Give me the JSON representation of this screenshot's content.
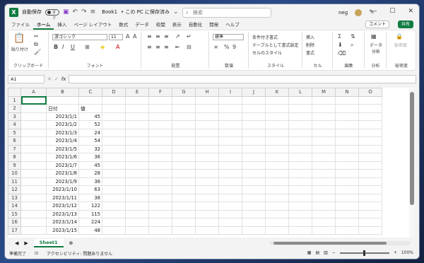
{
  "titlebar": {
    "autosave_label": "自動保存",
    "autosave_state": "オフ",
    "book_title": "Book1",
    "save_status": "• この PC に保存済み",
    "search_placeholder": "検索",
    "user_name": "neg"
  },
  "tabs": [
    "ファイル",
    "ホーム",
    "挿入",
    "ページ レイアウト",
    "数式",
    "データ",
    "校閲",
    "表示",
    "自動化",
    "開発",
    "ヘルプ"
  ],
  "active_tab": "ホーム",
  "comment_label": "コメント",
  "share_label": "共有",
  "ribbon": {
    "clipboard": {
      "paste": "貼り付け",
      "label": "クリップボード"
    },
    "font": {
      "name": "游ゴシック",
      "size": "11",
      "label": "フォント"
    },
    "alignment": {
      "label": "配置"
    },
    "number": {
      "format": "標準",
      "label": "数値"
    },
    "styles": {
      "conditional": "条件付き書式",
      "table": "テーブルとして書式設定",
      "cell": "セルのスタイル",
      "label": "スタイル"
    },
    "cells": {
      "insert": "挿入",
      "delete": "削除",
      "format": "書式",
      "label": "セル"
    },
    "editing": {
      "label": "編集"
    },
    "analysis": {
      "data_analysis": "データ分析",
      "label": "分析"
    },
    "sensitivity": {
      "label": "秘密度",
      "title": "秘密度"
    }
  },
  "formula_bar": {
    "cell_ref": "A1",
    "fx": "fx",
    "value": ""
  },
  "grid": {
    "columns": [
      "A",
      "B",
      "C",
      "D",
      "E",
      "F",
      "G",
      "H",
      "I",
      "J",
      "K",
      "L",
      "M",
      "N",
      "O"
    ],
    "header_date": "日付",
    "header_value": "値",
    "rows": [
      {
        "date": "2023/1/1",
        "value": "45"
      },
      {
        "date": "2023/1/2",
        "value": "52"
      },
      {
        "date": "2023/1/3",
        "value": "24"
      },
      {
        "date": "2023/1/4",
        "value": "54"
      },
      {
        "date": "2023/1/5",
        "value": "32"
      },
      {
        "date": "2023/1/6",
        "value": "36"
      },
      {
        "date": "2023/1/7",
        "value": "45"
      },
      {
        "date": "2023/1/8",
        "value": "28"
      },
      {
        "date": "2023/1/9",
        "value": "36"
      },
      {
        "date": "2023/1/10",
        "value": "63"
      },
      {
        "date": "2023/1/11",
        "value": "38"
      },
      {
        "date": "2023/1/12",
        "value": "122"
      },
      {
        "date": "2023/1/13",
        "value": "115"
      },
      {
        "date": "2023/1/14",
        "value": "224"
      },
      {
        "date": "2023/1/15",
        "value": "48"
      }
    ],
    "row_numbers": [
      "1",
      "2",
      "3",
      "4",
      "5",
      "6",
      "7",
      "8",
      "9",
      "10",
      "11",
      "12",
      "13",
      "14",
      "15",
      "16",
      "17"
    ]
  },
  "sheet_tab": "Sheet1",
  "status": {
    "ready": "準備完了",
    "accessibility": "アクセシビリティ: 問題ありません",
    "zoom": "100%"
  },
  "colors": {
    "accent": "#107c41"
  }
}
